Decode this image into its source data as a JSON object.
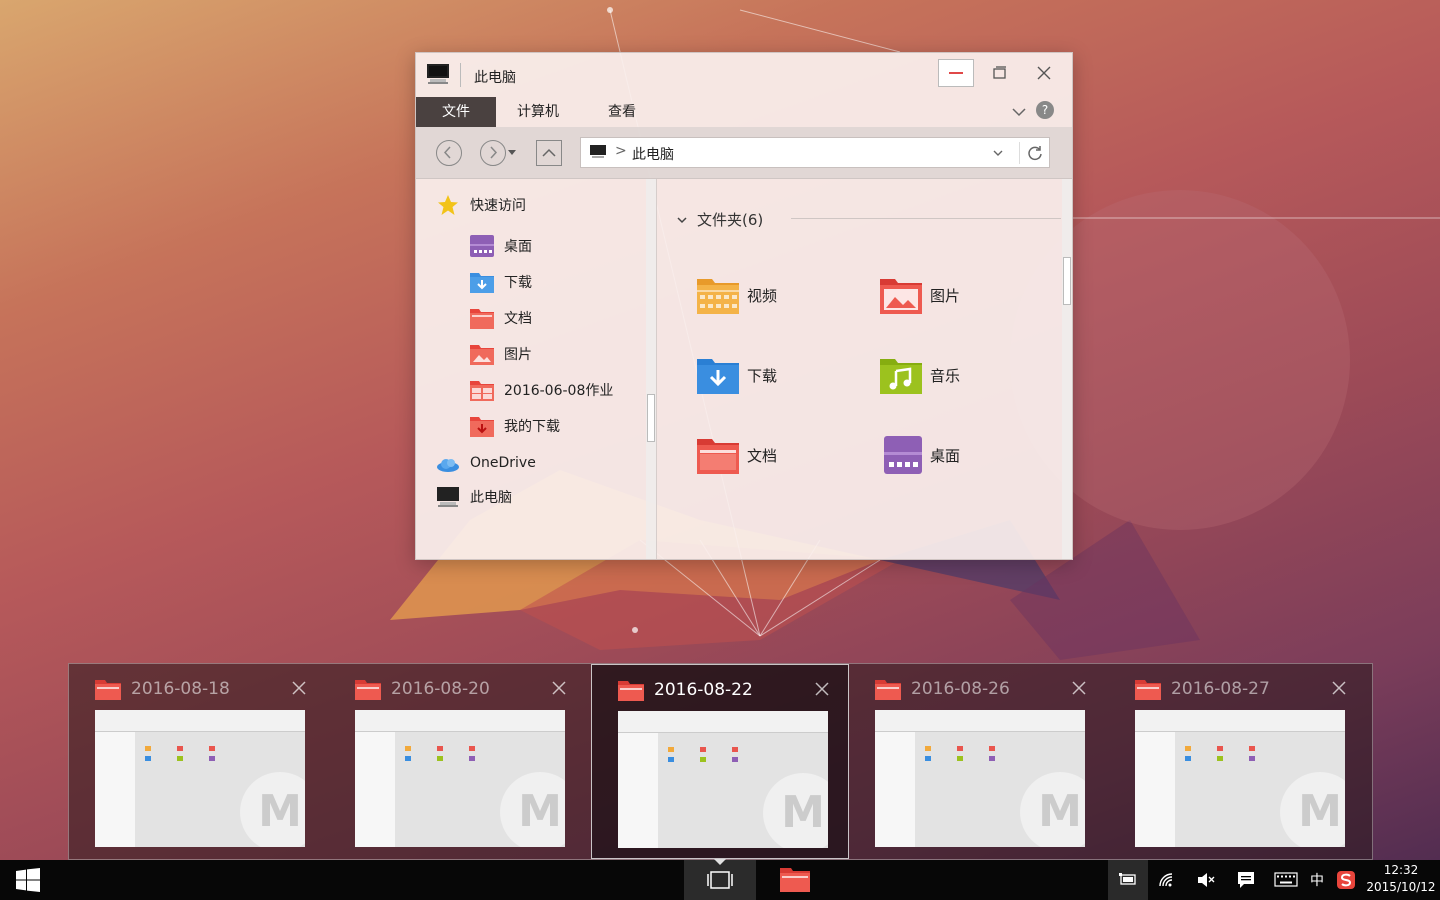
{
  "window": {
    "title": "此电脑",
    "tabs": [
      {
        "label": "文件",
        "active": true
      },
      {
        "label": "计算机",
        "active": false
      },
      {
        "label": "查看",
        "active": false
      }
    ],
    "help_label": "?",
    "address_path": "此电脑",
    "crumb_separator": ">"
  },
  "nav_pane": {
    "quick_access": "快速访问",
    "items": [
      {
        "label": "桌面",
        "icon": "desktop-folder-icon"
      },
      {
        "label": "下载",
        "icon": "download-folder-icon"
      },
      {
        "label": "文档",
        "icon": "documents-folder-icon"
      },
      {
        "label": "图片",
        "icon": "pictures-folder-icon"
      },
      {
        "label": "2016-06-08作业",
        "icon": "folder-icon"
      },
      {
        "label": "我的下载",
        "icon": "download-folder-icon"
      }
    ],
    "onedrive": "OneDrive",
    "this_pc": "此电脑"
  },
  "content": {
    "group_header": "文件夹(6)",
    "folders": [
      {
        "label": "视频",
        "icon": "videos-folder-icon",
        "color": "#f2a93b"
      },
      {
        "label": "图片",
        "icon": "pictures-folder-icon",
        "color": "#e9564e"
      },
      {
        "label": "下载",
        "icon": "download-folder-icon",
        "color": "#3a8ee0"
      },
      {
        "label": "音乐",
        "icon": "music-folder-icon",
        "color": "#9cc21e"
      },
      {
        "label": "文档",
        "icon": "documents-folder-icon",
        "color": "#ee5a50"
      },
      {
        "label": "桌面",
        "icon": "desktop-folder-icon",
        "color": "#8e5fb5"
      }
    ]
  },
  "switcher": {
    "cards": [
      {
        "label": "2016-08-18",
        "selected": false
      },
      {
        "label": "2016-08-20",
        "selected": false
      },
      {
        "label": "2016-08-22",
        "selected": true
      },
      {
        "label": "2016-08-26",
        "selected": false
      },
      {
        "label": "2016-08-27",
        "selected": false
      }
    ],
    "thumb_watermark": "M"
  },
  "taskbar": {
    "ime": "中",
    "time": "12:32",
    "date": "2015/10/12"
  },
  "colors": {
    "accent_dark": "#4a4140",
    "folder_red": "#ee5a50",
    "taskbar": "#070707"
  }
}
